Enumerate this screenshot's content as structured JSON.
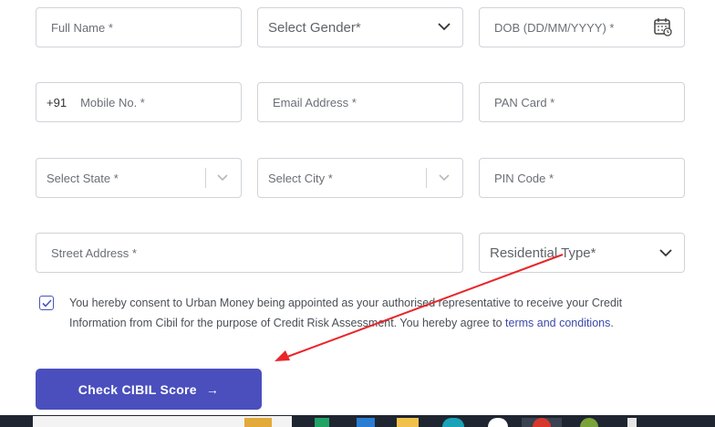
{
  "form": {
    "full_name": "Full Name *",
    "gender": "Select Gender*",
    "dob": "DOB (DD/MM/YYYY) *",
    "mobile_prefix": "+91",
    "mobile": "Mobile No. *",
    "email": "Email Address *",
    "pan": "PAN Card *",
    "state": "Select State *",
    "city": "Select City *",
    "pin": "PIN Code *",
    "street": "Street Address *",
    "residential_type": "Residential Type*"
  },
  "consent": {
    "checked": true,
    "text": "You hereby consent to Urban Money being appointed as your authorised representative to receive your Credit Information from Cibil for the purpose of Credit Risk Assessment. You hereby agree to ",
    "link": "terms and conditions",
    "end": "."
  },
  "cta": {
    "label": "Check CIBIL Score",
    "arrow": "→"
  },
  "colors": {
    "primary": "#4a4fbd",
    "annotation_arrow": "#e8262a",
    "border": "#cfd3d8"
  },
  "icons": [
    "calendar-icon",
    "chevron-down-icon",
    "check-icon",
    "arrow-right-icon"
  ]
}
